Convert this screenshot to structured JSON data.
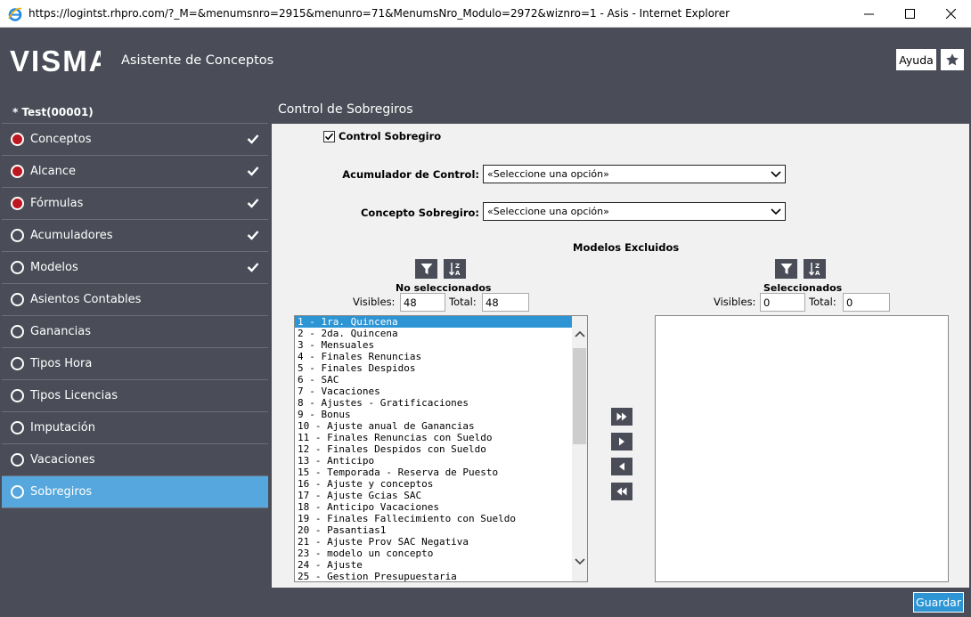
{
  "window": {
    "title": "https://logintst.rhpro.com/?_M=&menumsnro=2915&menunro=71&MenumsNro_Modulo=2972&wiznro=1 - Asis - Internet Explorer"
  },
  "header": {
    "logo_text": "VISMA",
    "app_title": "Asistente de Conceptos",
    "help_label": "Ayuda"
  },
  "sidebar": {
    "heading": "* Test(00001)",
    "items": [
      {
        "label": "Conceptos",
        "status": "red",
        "checked": true
      },
      {
        "label": "Alcance",
        "status": "red",
        "checked": true
      },
      {
        "label": "Fórmulas",
        "status": "red",
        "checked": true
      },
      {
        "label": "Acumuladores",
        "status": "empty",
        "checked": true
      },
      {
        "label": "Modelos",
        "status": "empty",
        "checked": true
      },
      {
        "label": "Asientos Contables",
        "status": "empty",
        "checked": false
      },
      {
        "label": "Ganancias",
        "status": "empty",
        "checked": false
      },
      {
        "label": "Tipos Hora",
        "status": "empty",
        "checked": false
      },
      {
        "label": "Tipos Licencias",
        "status": "empty",
        "checked": false
      },
      {
        "label": "Imputación",
        "status": "empty",
        "checked": false
      },
      {
        "label": "Vacaciones",
        "status": "empty",
        "checked": false
      },
      {
        "label": "Sobregiros",
        "status": "empty",
        "checked": false,
        "active": true
      }
    ]
  },
  "main": {
    "title": "Control de Sobregiros",
    "control_checkbox_label": "Control Sobregiro",
    "acumulador_label": "Acumulador de Control:",
    "acumulador_value": "«Seleccione una opción»",
    "concepto_label": "Concepto Sobregiro:",
    "concepto_value": "«Seleccione una opción»",
    "models_title": "Modelos Excluidos",
    "left": {
      "title": "No seleccionados",
      "visibles_label": "Visibles:",
      "visibles_value": "48",
      "total_label": "Total:",
      "total_value": "48",
      "items": [
        "1 - 1ra. Quincena",
        "2 - 2da. Quincena",
        "3 - Mensuales",
        "4 - Finales Renuncias",
        "5 - Finales Despidos",
        "6 - SAC",
        "7 - Vacaciones",
        "8 - Ajustes - Gratificaciones",
        "9 - Bonus",
        "10 - Ajuste anual de Ganancias",
        "11 - Finales Renuncias con Sueldo",
        "12 - Finales Despidos con Sueldo",
        "13 - Anticipo",
        "15 - Temporada - Reserva de Puesto",
        "16 - Ajuste y conceptos",
        "17 - Ajuste Gcias SAC",
        "18 - Anticipo Vacaciones",
        "19 - Finales Fallecimiento con Sueldo",
        "20 - Pasantias1",
        "21 - Ajuste Prov SAC Negativa",
        "23 - modelo un concepto",
        "24 - Ajuste",
        "25 - Gestion Presupuestaria"
      ]
    },
    "right": {
      "title": "Seleccionados",
      "visibles_label": "Visibles:",
      "visibles_value": "0",
      "total_label": "Total:",
      "total_value": "0"
    },
    "save_label": "Guardar"
  },
  "colors": {
    "dark": "#4a4d57",
    "accent": "#55a7dd",
    "button_blue": "#2d95d4",
    "status_red": "#c0161f"
  }
}
